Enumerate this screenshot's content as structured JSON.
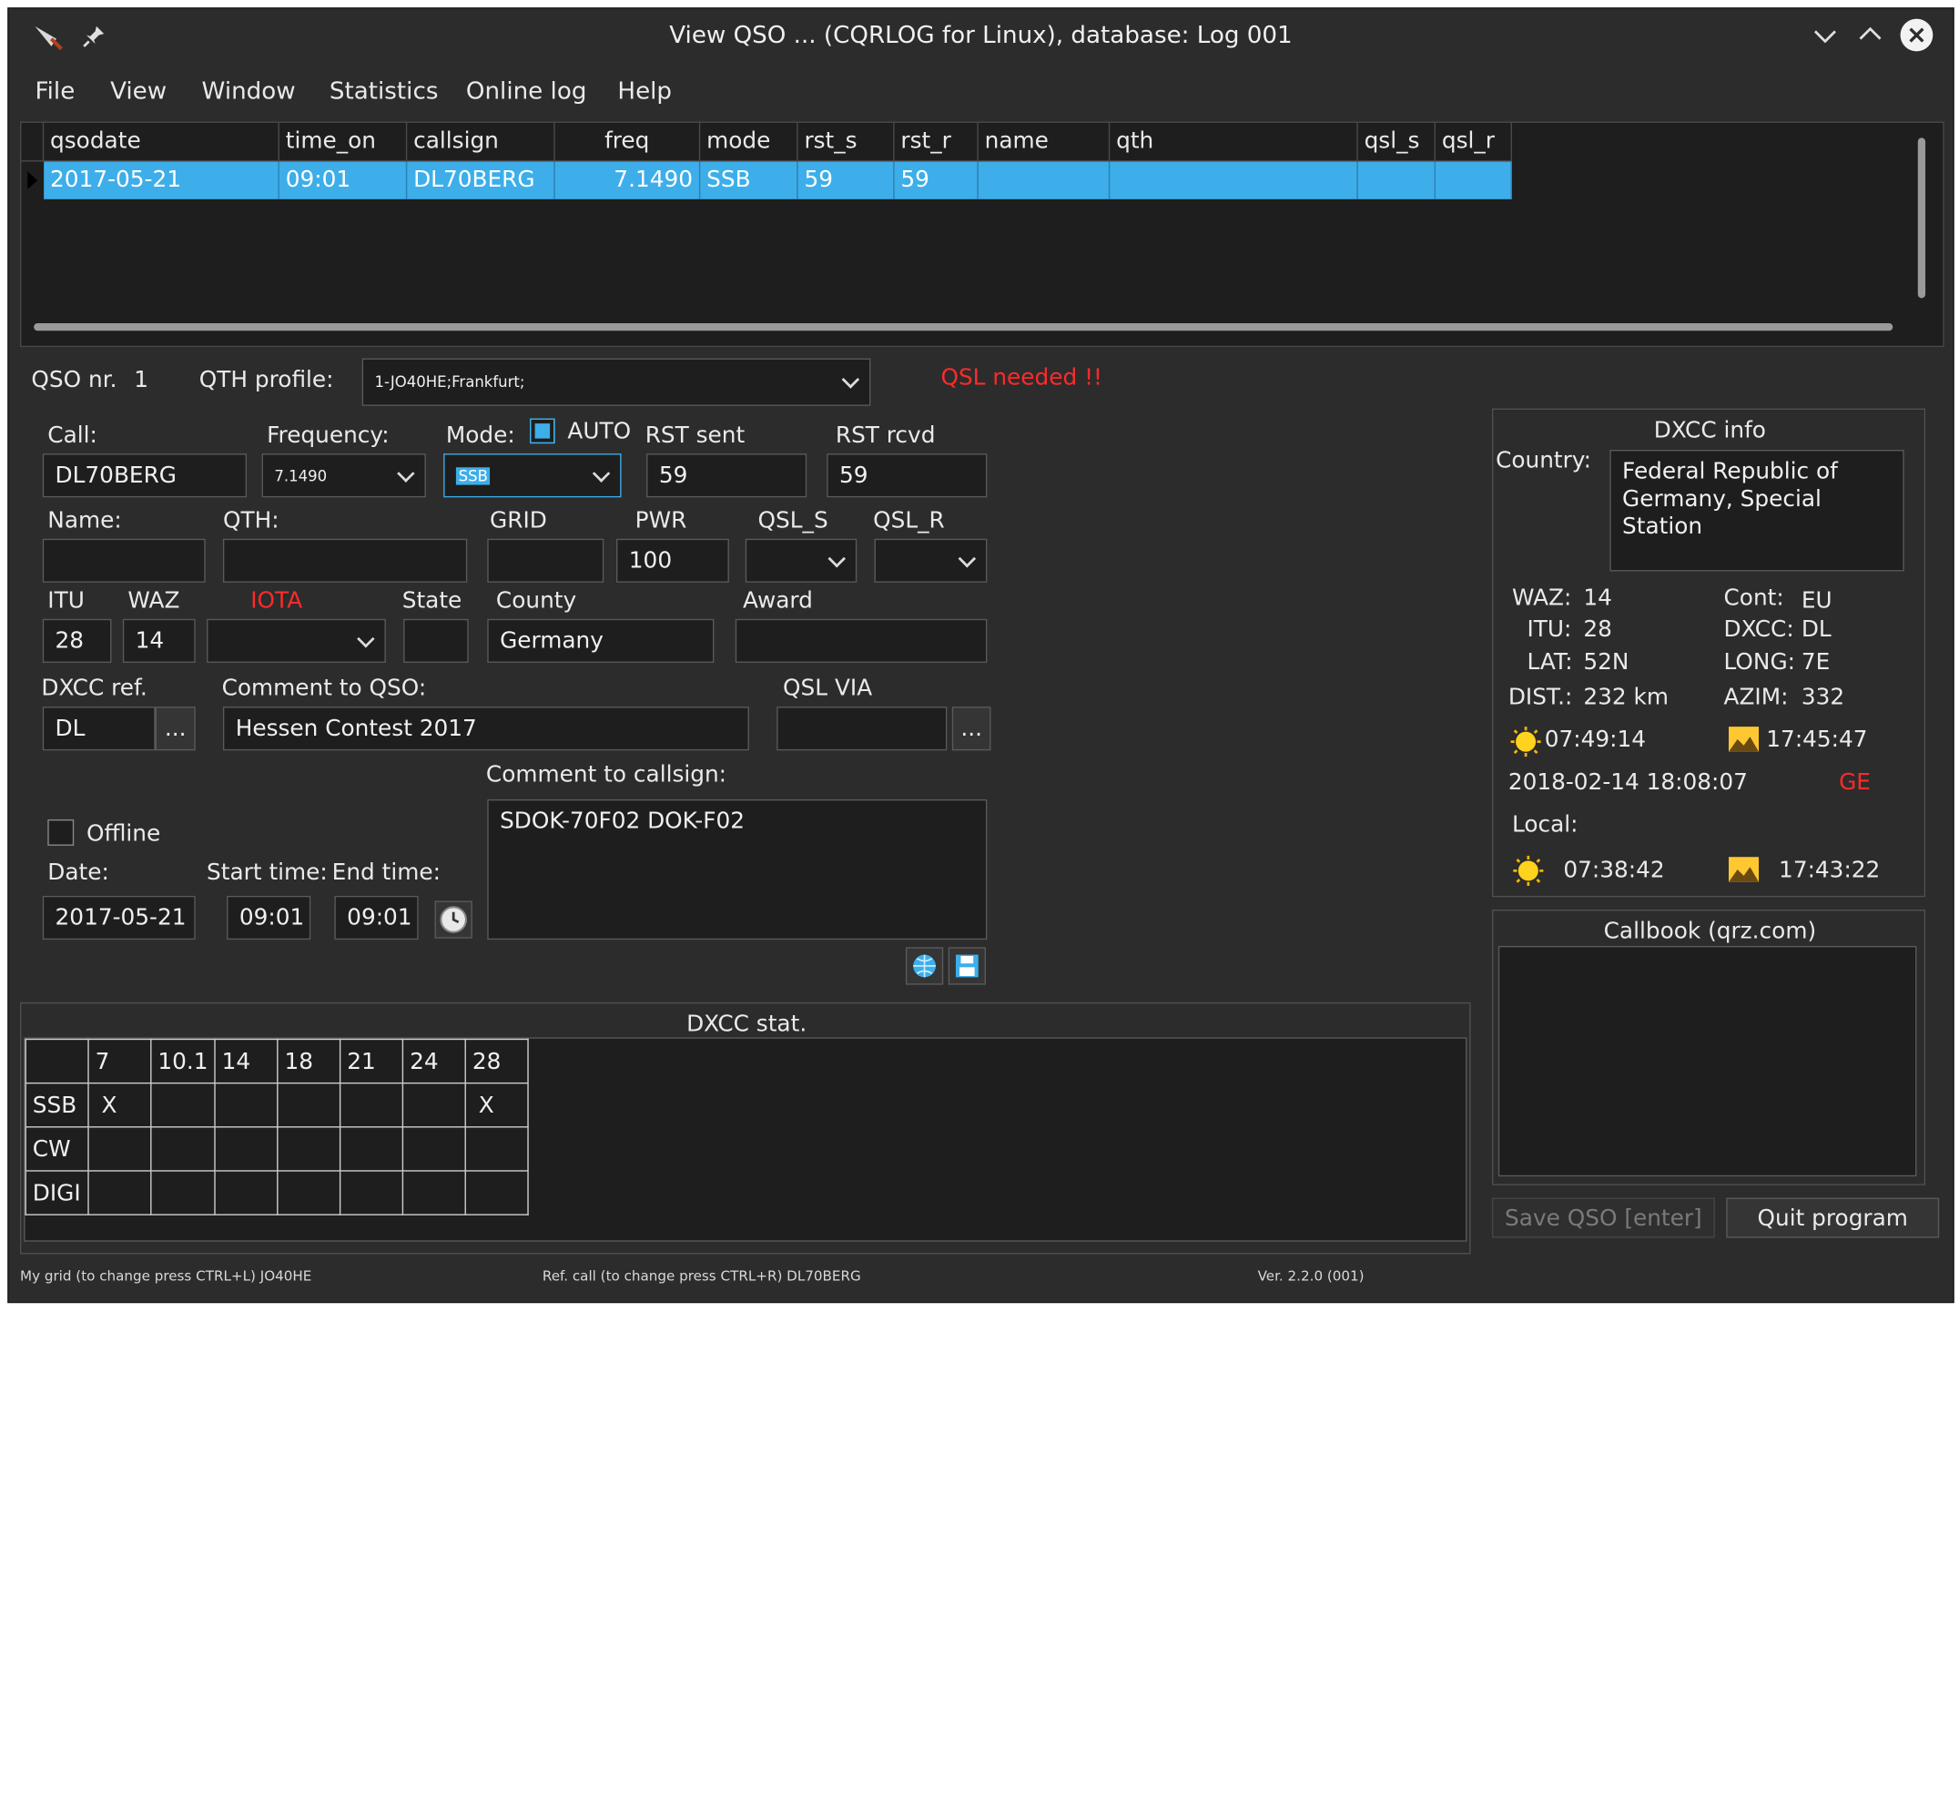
{
  "window": {
    "title": "View QSO ... (CQRLOG for Linux), database: Log 001"
  },
  "menu": [
    "File",
    "View",
    "Window",
    "Statistics",
    "Online log",
    "Help"
  ],
  "grid": {
    "columns": [
      "qsodate",
      "time_on",
      "callsign",
      "freq",
      "mode",
      "rst_s",
      "rst_r",
      "name",
      "qth",
      "qsl_s",
      "qsl_r"
    ],
    "row": [
      "2017-05-21",
      "09:01",
      "DL70BERG",
      "7.1490",
      "SSB",
      "59",
      "59",
      "",
      "",
      "",
      ""
    ]
  },
  "qso": {
    "nr_label": "QSO nr.",
    "nr": "1",
    "qth_profile_label": "QTH profile:",
    "qth_profile": "1-JO40HE;Frankfurt;",
    "qsl_needed": "QSL needed !!"
  },
  "form": {
    "call_label": "Call:",
    "call": "DL70BERG",
    "freq_label": "Frequency:",
    "freq": "7.1490",
    "mode_label": "Mode:",
    "auto_label": "AUTO",
    "mode": "SSB",
    "rst_sent_label": "RST sent",
    "rst_sent": "59",
    "rst_rcvd_label": "RST rcvd",
    "rst_rcvd": "59",
    "name_label": "Name:",
    "name": "",
    "qth_label": "QTH:",
    "qth": "",
    "grid_label": "GRID",
    "grid": "",
    "pwr_label": "PWR",
    "pwr": "100",
    "qsl_s_label": "QSL_S",
    "qsl_r_label": "QSL_R",
    "itu_label": "ITU",
    "itu": "28",
    "waz_label": "WAZ",
    "waz": "14",
    "iota_label": "IOTA",
    "state_label": "State",
    "state": "",
    "county_label": "County",
    "county": "Germany",
    "award_label": "Award",
    "award": "",
    "dxcc_ref_label": "DXCC ref.",
    "dxcc_ref": "DL",
    "comment_qso_label": "Comment to QSO:",
    "comment_qso": "Hessen Contest 2017",
    "qsl_via_label": "QSL VIA",
    "qsl_via": "",
    "dots": "...",
    "comment_call_label": "Comment to callsign:",
    "comment_call": "SDOK-70F02 DOK-F02",
    "offline_label": "Offline",
    "date_label": "Date:",
    "date": "2017-05-21",
    "start_label": "Start time:",
    "start": "09:01",
    "end_label": "End time:",
    "end": "09:01"
  },
  "dxcc_info": {
    "title": "DXCC info",
    "country_label": "Country:",
    "country": "Federal Republic of Germany, Special Station",
    "waz_label": "WAZ:",
    "waz": "14",
    "cont_label": "Cont:",
    "cont": "EU",
    "itu_label": "ITU:",
    "itu": "28",
    "dxcc_label": "DXCC:",
    "dxcc": "DL",
    "lat_label": "LAT:",
    "lat": "52N",
    "long_label": "LONG:",
    "long": "7E",
    "dist_label": "DIST.:",
    "dist": "232 km",
    "azim_label": "AZIM:",
    "azim": "332",
    "sunrise": "07:49:14",
    "sunset": "17:45:47",
    "datetime": "2018-02-14  18:08:07",
    "ge": "GE",
    "local_label": "Local:",
    "local_sunrise": "07:38:42",
    "local_sunset": "17:43:22"
  },
  "callbook": {
    "title": "Callbook (qrz.com)"
  },
  "dxcc_stat": {
    "title": "DXCC stat.",
    "bands": [
      "7",
      "10.1",
      "14",
      "18",
      "21",
      "24",
      "28"
    ],
    "rows": [
      {
        "mode": "SSB",
        "cells": [
          "X",
          "",
          "",
          "",
          "",
          "",
          "X"
        ]
      },
      {
        "mode": "CW",
        "cells": [
          "",
          "",
          "",
          "",
          "",
          "",
          ""
        ]
      },
      {
        "mode": "DIGI",
        "cells": [
          "",
          "",
          "",
          "",
          "",
          "",
          ""
        ]
      }
    ]
  },
  "buttons": {
    "save": "Save QSO [enter]",
    "quit": "Quit program"
  },
  "status": {
    "grid": "My grid (to change press CTRL+L) JO40HE",
    "ref": "Ref. call (to change press CTRL+R)   DL70BERG",
    "ver": "Ver. 2.2.0 (001)"
  },
  "colors": {
    "accent": "#3daee9",
    "background": "#2c2c2c",
    "alert": "#ff2a2a"
  }
}
